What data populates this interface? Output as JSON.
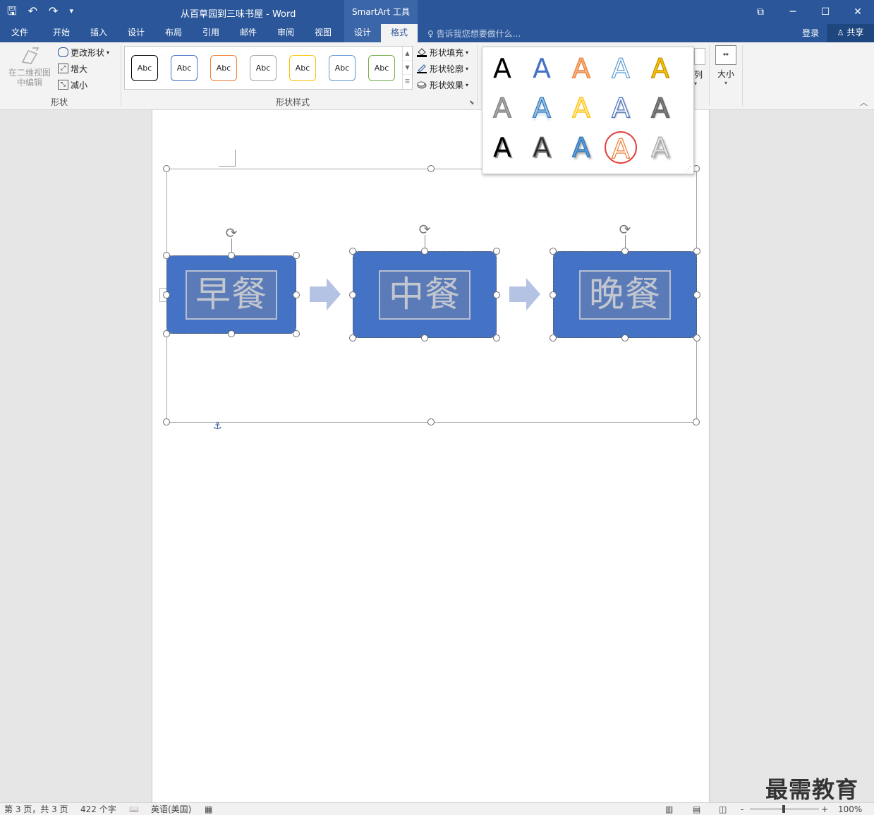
{
  "titlebar": {
    "doc_title": "从百草园到三味书屋 - Word",
    "context_tools": "SmartArt 工具",
    "qat": {
      "save": "🖫",
      "undo": "↶",
      "redo": "↷",
      "customize": "▾"
    },
    "window_controls": {
      "ribbon_opts": "⧉",
      "minimize": "─",
      "maximize": "☐",
      "close": "✕"
    }
  },
  "tabs": {
    "file": "文件",
    "home": "开始",
    "insert": "插入",
    "design_doc": "设计",
    "layout": "布局",
    "references": "引用",
    "mailings": "邮件",
    "review": "审阅",
    "view": "视图",
    "design": "设计",
    "format": "格式"
  },
  "tell_me": {
    "icon": "♀",
    "placeholder": "告诉我您想要做什么..."
  },
  "account": {
    "login": "登录",
    "share": "共享"
  },
  "ribbon": {
    "shapes_group": {
      "edit_in_2d": "在二维视图中编辑",
      "change_shape": "更改形状",
      "larger": "增大",
      "smaller": "减小",
      "label": "形状"
    },
    "shape_styles": {
      "label": "形状样式",
      "swatches": [
        "Abc",
        "Abc",
        "Abc",
        "Abc",
        "Abc",
        "Abc",
        "Abc"
      ],
      "swatch_colors": [
        "#000000",
        "#4472c4",
        "#ed7d31",
        "#a5a5a5",
        "#ffc000",
        "#5b9bd5",
        "#70ad47"
      ],
      "shape_fill": "形状填充",
      "shape_outline": "形状轮廓",
      "shape_effects": "形状效果"
    },
    "arrange_partial": "列",
    "size": "大小"
  },
  "wordart": {
    "glyph": "A",
    "rows": [
      [
        {
          "fill": "#000000",
          "stroke": "none",
          "shadow": ""
        },
        {
          "fill": "#4472c4",
          "stroke": "none",
          "shadow": ""
        },
        {
          "fill": "#f4b183",
          "stroke": "#ed7d31",
          "shadow": ""
        },
        {
          "fill": "#ffffff",
          "stroke": "#5b9bd5",
          "shadow": ""
        },
        {
          "fill": "#ffc000",
          "stroke": "#bf9000",
          "shadow": ""
        }
      ],
      [
        {
          "fill": "#a5a5a5",
          "stroke": "#7f7f7f",
          "shadow": ""
        },
        {
          "fill": "#9dc3e6",
          "stroke": "#2e75b6",
          "shadow": "reflect"
        },
        {
          "fill": "#ffe699",
          "stroke": "#ffc000",
          "shadow": ""
        },
        {
          "fill": "#ffffff",
          "stroke": "#4472c4",
          "shadow": "outer"
        },
        {
          "fill": "#7f7f7f",
          "stroke": "#595959",
          "shadow": "outer"
        }
      ],
      [
        {
          "fill": "#000000",
          "stroke": "none",
          "shadow": "hard"
        },
        {
          "fill": "#262626",
          "stroke": "#7f7f7f",
          "shadow": "hard"
        },
        {
          "fill": "#5b9bd5",
          "stroke": "#2e75b6",
          "shadow": "soft"
        },
        {
          "fill": "#ffffff",
          "stroke": "#ed7d31",
          "shadow": ""
        },
        {
          "fill": "#e7e6e6",
          "stroke": "#a5a5a5",
          "shadow": "soft"
        }
      ]
    ],
    "highlight": [
      2,
      3
    ],
    "highlight_color": "#e34040"
  },
  "diagram": {
    "nodes": [
      "早餐",
      "中餐",
      "晚餐"
    ],
    "node_color": "#4472c4",
    "arrow_color": "#b4c3e3",
    "rotate_icon": "⟳",
    "expand": "‹",
    "anchor": "⚓"
  },
  "statusbar": {
    "page": "第 3 页，共 3 页",
    "words": "422 个字",
    "proof_icon": "📖",
    "language": "英语(美国)",
    "macro_icon": "▦",
    "read_mode": "▥",
    "print_layout": "▤",
    "web_layout": "◫",
    "zoom_minus": "-",
    "zoom_plus": "+",
    "zoom": "100%"
  },
  "watermark": "最需教育"
}
